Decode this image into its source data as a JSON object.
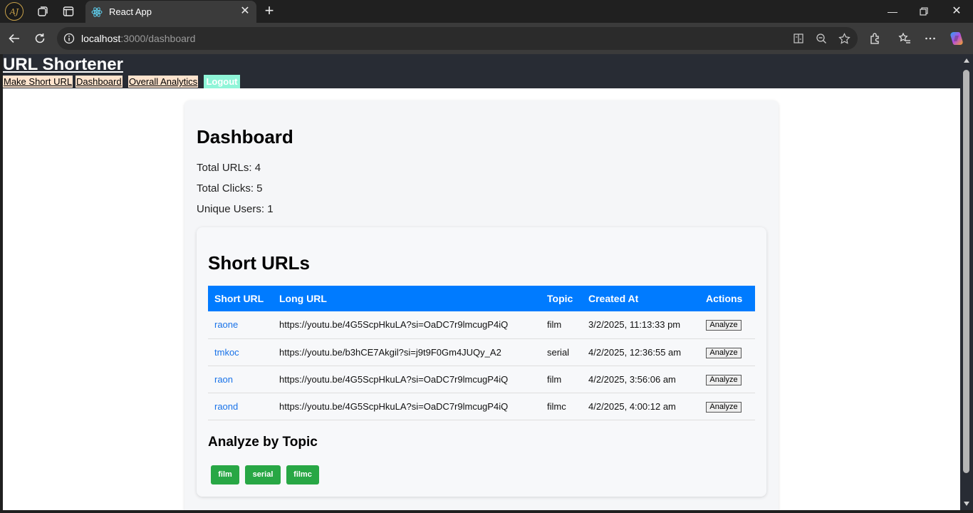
{
  "browser": {
    "profile_initials": "AJ",
    "tab_title": "React App",
    "url_host": "localhost",
    "url_rest": ":3000/dashboard"
  },
  "app": {
    "title": "URL Shortener",
    "nav": [
      "Make Short URL",
      "Dashboard",
      "Overall Analytics"
    ],
    "logout_label": "Logout"
  },
  "dashboard": {
    "heading": "Dashboard",
    "total_urls": "Total URLs: 4",
    "total_clicks": "Total Clicks: 5",
    "unique_users": "Unique Users: 1"
  },
  "short_urls": {
    "heading": "Short URLs",
    "columns": [
      "Short URL",
      "Long URL",
      "Topic",
      "Created At",
      "Actions"
    ],
    "rows": [
      {
        "short": "raone",
        "long": "https://youtu.be/4G5ScpHkuLA?si=OaDC7r9lmcugP4iQ",
        "topic": "film",
        "created": "3/2/2025, 11:13:33 pm",
        "action": "Analyze"
      },
      {
        "short": "tmkoc",
        "long": "https://youtu.be/b3hCE7Akgil?si=j9t9F0Gm4JUQy_A2",
        "topic": "serial",
        "created": "4/2/2025, 12:36:55 am",
        "action": "Analyze"
      },
      {
        "short": "raon",
        "long": "https://youtu.be/4G5ScpHkuLA?si=OaDC7r9lmcugP4iQ",
        "topic": "film",
        "created": "4/2/2025, 3:56:06 am",
        "action": "Analyze"
      },
      {
        "short": "raond",
        "long": "https://youtu.be/4G5ScpHkuLA?si=OaDC7r9lmcugP4iQ",
        "topic": "filmc",
        "created": "4/2/2025, 4:00:12 am",
        "action": "Analyze"
      }
    ]
  },
  "topics": {
    "heading": "Analyze by Topic",
    "buttons": [
      "film",
      "serial",
      "filmc"
    ]
  },
  "colors": {
    "header_bg": "#282c34",
    "table_header": "#007bff",
    "topic_button": "#28a745",
    "link": "#1a73e8",
    "logout_bg": "#8ff5d8",
    "nav_link_bg": "#fde3cd"
  }
}
